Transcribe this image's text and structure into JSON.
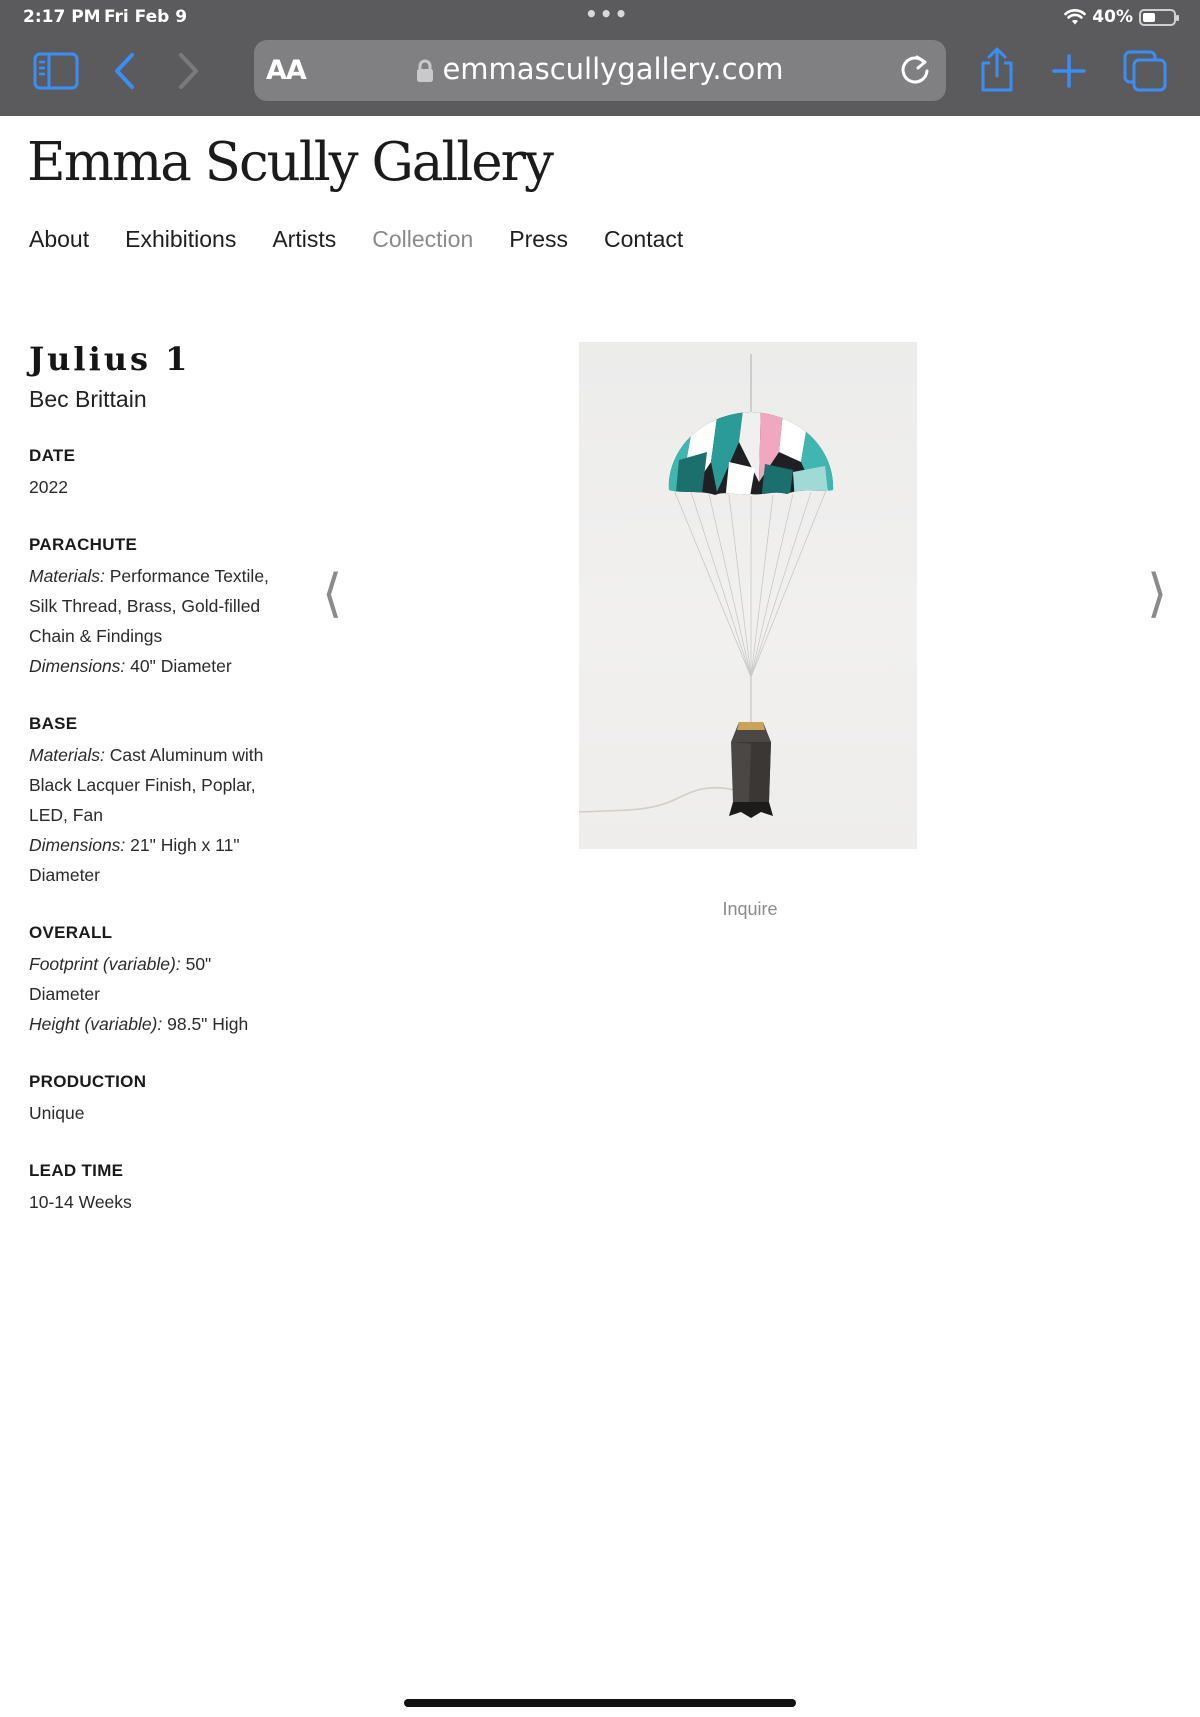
{
  "status_bar": {
    "time": "2:17 PM",
    "date": "Fri Feb 9",
    "battery": "40%"
  },
  "browser": {
    "aa_label": "AA",
    "url": "emmascullygallery.com"
  },
  "site": {
    "title": "Emma Scully Gallery",
    "nav": [
      "About",
      "Exhibitions",
      "Artists",
      "Collection",
      "Press",
      "Contact"
    ],
    "active_nav": "Collection"
  },
  "work": {
    "title": "Julius 1",
    "artist": "Bec Brittain",
    "date_head": "DATE",
    "date": "2022",
    "parachute": {
      "head": "PARACHUTE",
      "materials_label": "Materials:",
      "materials_1": " Performance Textile,",
      "materials_2": "Silk Thread, Brass, Gold-filled",
      "materials_3": "Chain & Findings",
      "dimensions_label": "Dimensions:",
      "dimensions": " 40\" Diameter"
    },
    "base": {
      "head": "BASE",
      "materials_label": "Materials:",
      "materials_1": " Cast Aluminum with",
      "materials_2": "Black Lacquer Finish, Poplar,",
      "materials_3": "LED, Fan",
      "dimensions_label": "Dimensions:",
      "dimensions_1": " 21\" High x 11\"",
      "dimensions_2": "Diameter"
    },
    "overall": {
      "head": "OVERALL",
      "footprint_label": "Footprint (variable):",
      "footprint_1": " 50\"",
      "footprint_2": "Diameter",
      "height_label": "Height (variable):",
      "height": " 98.5\" High"
    },
    "production_head": "PRODUCTION",
    "production": "Unique",
    "lead_time_head": "LEAD TIME",
    "lead_time": "10-14 Weeks",
    "inquire": "Inquire"
  },
  "gallery": {
    "prev_arrow": "⟨",
    "next_arrow": "⟩"
  },
  "colors": {
    "chrome_bg": "#5b5b5d",
    "ios_blue": "#3a8ef6",
    "muted_text": "#8a8a8a"
  },
  "icons": [
    "sidebar-icon",
    "back-chevron-icon",
    "forward-chevron-icon",
    "lock-icon",
    "reload-icon",
    "share-icon",
    "new-tab-plus-icon",
    "tabs-icon",
    "wifi-icon",
    "battery-icon"
  ]
}
